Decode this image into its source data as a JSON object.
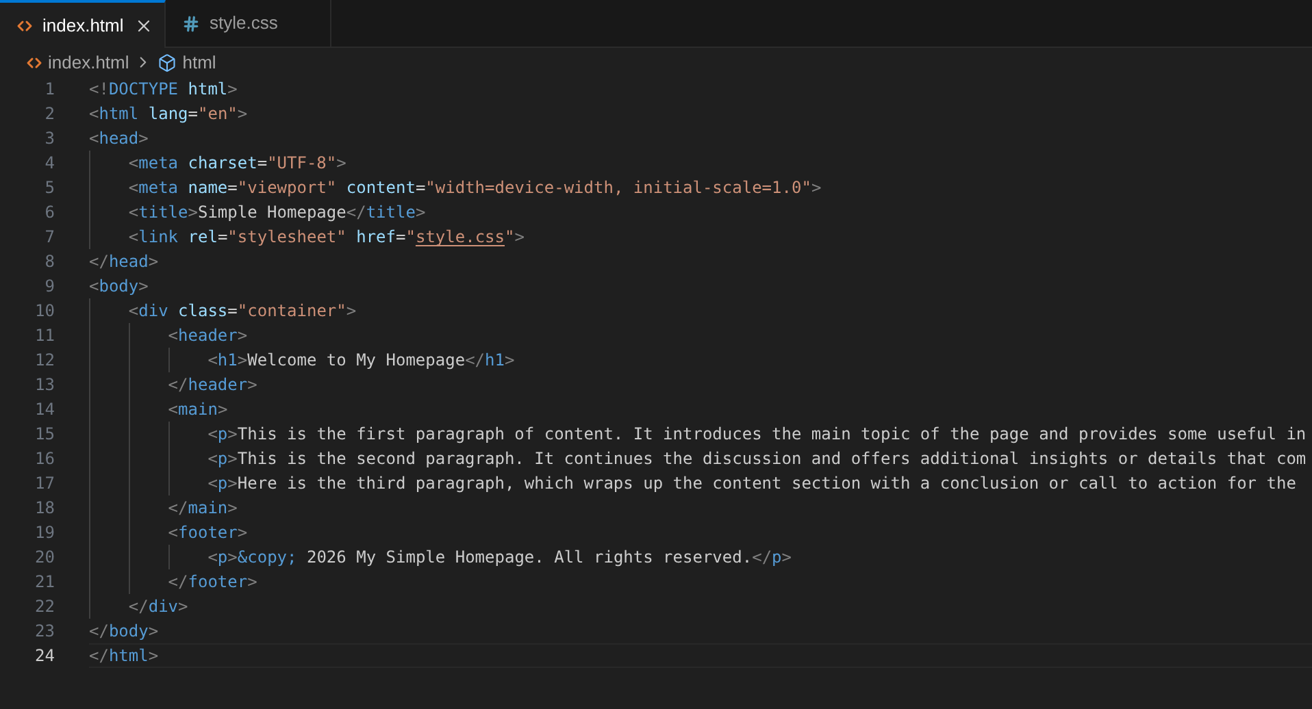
{
  "tabs": [
    {
      "label": "index.html",
      "kind": "html",
      "selected": true
    },
    {
      "label": "style.css",
      "kind": "css",
      "selected": false
    }
  ],
  "breadcrumb": [
    {
      "label": "index.html",
      "kind": "file"
    },
    {
      "label": "html",
      "kind": "element"
    }
  ],
  "editor": {
    "lines": [
      {
        "number": "1",
        "current": false,
        "tokens": [
          {
            "kind": "punct",
            "text": "<!"
          },
          {
            "kind": "tag",
            "text": "DOCTYPE"
          },
          {
            "kind": "attr",
            "text": " html"
          },
          {
            "kind": "punct",
            "text": ">"
          }
        ]
      },
      {
        "number": "2",
        "current": false,
        "tokens": [
          {
            "kind": "punct",
            "text": "<"
          },
          {
            "kind": "tag",
            "text": "html"
          },
          {
            "kind": "attr",
            "text": " lang"
          },
          {
            "kind": "text",
            "text": "="
          },
          {
            "kind": "string",
            "text": "\"en\""
          },
          {
            "kind": "punct",
            "text": ">"
          }
        ]
      },
      {
        "number": "3",
        "current": false,
        "tokens": [
          {
            "kind": "punct",
            "text": "<"
          },
          {
            "kind": "tag",
            "text": "head"
          },
          {
            "kind": "punct",
            "text": ">"
          }
        ]
      },
      {
        "number": "4",
        "current": false,
        "tokens": [
          {
            "kind": "punct",
            "text": "    <"
          },
          {
            "kind": "tag",
            "text": "meta"
          },
          {
            "kind": "attr",
            "text": " charset"
          },
          {
            "kind": "text",
            "text": "="
          },
          {
            "kind": "string",
            "text": "\"UTF-8\""
          },
          {
            "kind": "punct",
            "text": ">"
          }
        ]
      },
      {
        "number": "5",
        "current": false,
        "tokens": [
          {
            "kind": "punct",
            "text": "    <"
          },
          {
            "kind": "tag",
            "text": "meta"
          },
          {
            "kind": "attr",
            "text": " name"
          },
          {
            "kind": "text",
            "text": "="
          },
          {
            "kind": "string",
            "text": "\"viewport\""
          },
          {
            "kind": "attr",
            "text": " content"
          },
          {
            "kind": "text",
            "text": "="
          },
          {
            "kind": "string",
            "text": "\"width=device-width, initial-scale=1.0\""
          },
          {
            "kind": "punct",
            "text": ">"
          }
        ]
      },
      {
        "number": "6",
        "current": false,
        "tokens": [
          {
            "kind": "punct",
            "text": "    <"
          },
          {
            "kind": "tag",
            "text": "title"
          },
          {
            "kind": "punct",
            "text": ">"
          },
          {
            "kind": "text",
            "text": "Simple Homepage"
          },
          {
            "kind": "punct",
            "text": "</"
          },
          {
            "kind": "tag",
            "text": "title"
          },
          {
            "kind": "punct",
            "text": ">"
          }
        ]
      },
      {
        "number": "7",
        "current": false,
        "tokens": [
          {
            "kind": "punct",
            "text": "    <"
          },
          {
            "kind": "tag",
            "text": "link"
          },
          {
            "kind": "attr",
            "text": " rel"
          },
          {
            "kind": "text",
            "text": "="
          },
          {
            "kind": "string",
            "text": "\"stylesheet\""
          },
          {
            "kind": "attr",
            "text": " href"
          },
          {
            "kind": "text",
            "text": "="
          },
          {
            "kind": "string",
            "text": "\""
          },
          {
            "kind": "link",
            "text": "style.css"
          },
          {
            "kind": "string",
            "text": "\""
          },
          {
            "kind": "punct",
            "text": ">"
          }
        ]
      },
      {
        "number": "8",
        "current": false,
        "tokens": [
          {
            "kind": "punct",
            "text": "</"
          },
          {
            "kind": "tag",
            "text": "head"
          },
          {
            "kind": "punct",
            "text": ">"
          }
        ]
      },
      {
        "number": "9",
        "current": false,
        "tokens": [
          {
            "kind": "punct",
            "text": "<"
          },
          {
            "kind": "tag",
            "text": "body"
          },
          {
            "kind": "punct",
            "text": ">"
          }
        ]
      },
      {
        "number": "10",
        "current": false,
        "tokens": [
          {
            "kind": "punct",
            "text": "    <"
          },
          {
            "kind": "tag",
            "text": "div"
          },
          {
            "kind": "attr",
            "text": " class"
          },
          {
            "kind": "text",
            "text": "="
          },
          {
            "kind": "string",
            "text": "\"container\""
          },
          {
            "kind": "punct",
            "text": ">"
          }
        ]
      },
      {
        "number": "11",
        "current": false,
        "tokens": [
          {
            "kind": "punct",
            "text": "        <"
          },
          {
            "kind": "tag",
            "text": "header"
          },
          {
            "kind": "punct",
            "text": ">"
          }
        ]
      },
      {
        "number": "12",
        "current": false,
        "tokens": [
          {
            "kind": "punct",
            "text": "            <"
          },
          {
            "kind": "tag",
            "text": "h1"
          },
          {
            "kind": "punct",
            "text": ">"
          },
          {
            "kind": "text",
            "text": "Welcome to My Homepage"
          },
          {
            "kind": "punct",
            "text": "</"
          },
          {
            "kind": "tag",
            "text": "h1"
          },
          {
            "kind": "punct",
            "text": ">"
          }
        ]
      },
      {
        "number": "13",
        "current": false,
        "tokens": [
          {
            "kind": "punct",
            "text": "        </"
          },
          {
            "kind": "tag",
            "text": "header"
          },
          {
            "kind": "punct",
            "text": ">"
          }
        ]
      },
      {
        "number": "14",
        "current": false,
        "tokens": [
          {
            "kind": "punct",
            "text": "        <"
          },
          {
            "kind": "tag",
            "text": "main"
          },
          {
            "kind": "punct",
            "text": ">"
          }
        ]
      },
      {
        "number": "15",
        "current": false,
        "tokens": [
          {
            "kind": "punct",
            "text": "            <"
          },
          {
            "kind": "tag",
            "text": "p"
          },
          {
            "kind": "punct",
            "text": ">"
          },
          {
            "kind": "text",
            "text": "This is the first paragraph of content. It introduces the main topic of the page and provides some useful in"
          }
        ]
      },
      {
        "number": "16",
        "current": false,
        "tokens": [
          {
            "kind": "punct",
            "text": "            <"
          },
          {
            "kind": "tag",
            "text": "p"
          },
          {
            "kind": "punct",
            "text": ">"
          },
          {
            "kind": "text",
            "text": "This is the second paragraph. It continues the discussion and offers additional insights or details that com"
          }
        ]
      },
      {
        "number": "17",
        "current": false,
        "tokens": [
          {
            "kind": "punct",
            "text": "            <"
          },
          {
            "kind": "tag",
            "text": "p"
          },
          {
            "kind": "punct",
            "text": ">"
          },
          {
            "kind": "text",
            "text": "Here is the third paragraph, which wraps up the content section with a conclusion or call to action for the"
          }
        ]
      },
      {
        "number": "18",
        "current": false,
        "tokens": [
          {
            "kind": "punct",
            "text": "        </"
          },
          {
            "kind": "tag",
            "text": "main"
          },
          {
            "kind": "punct",
            "text": ">"
          }
        ]
      },
      {
        "number": "19",
        "current": false,
        "tokens": [
          {
            "kind": "punct",
            "text": "        <"
          },
          {
            "kind": "tag",
            "text": "footer"
          },
          {
            "kind": "punct",
            "text": ">"
          }
        ]
      },
      {
        "number": "20",
        "current": false,
        "tokens": [
          {
            "kind": "punct",
            "text": "            <"
          },
          {
            "kind": "tag",
            "text": "p"
          },
          {
            "kind": "punct",
            "text": ">"
          },
          {
            "kind": "tag",
            "text": "&copy;"
          },
          {
            "kind": "text",
            "text": " 2026 My Simple Homepage. All rights reserved."
          },
          {
            "kind": "punct",
            "text": "</"
          },
          {
            "kind": "tag",
            "text": "p"
          },
          {
            "kind": "punct",
            "text": ">"
          }
        ]
      },
      {
        "number": "21",
        "current": false,
        "tokens": [
          {
            "kind": "punct",
            "text": "        </"
          },
          {
            "kind": "tag",
            "text": "footer"
          },
          {
            "kind": "punct",
            "text": ">"
          }
        ]
      },
      {
        "number": "22",
        "current": false,
        "tokens": [
          {
            "kind": "punct",
            "text": "    </"
          },
          {
            "kind": "tag",
            "text": "div"
          },
          {
            "kind": "punct",
            "text": ">"
          }
        ]
      },
      {
        "number": "23",
        "current": false,
        "tokens": [
          {
            "kind": "punct",
            "text": "</"
          },
          {
            "kind": "tag",
            "text": "body"
          },
          {
            "kind": "punct",
            "text": ">"
          }
        ]
      },
      {
        "number": "24",
        "current": true,
        "tokens": [
          {
            "kind": "punct",
            "text": "</"
          },
          {
            "kind": "tag",
            "text": "html"
          },
          {
            "kind": "punct",
            "text": ">"
          }
        ]
      }
    ]
  }
}
